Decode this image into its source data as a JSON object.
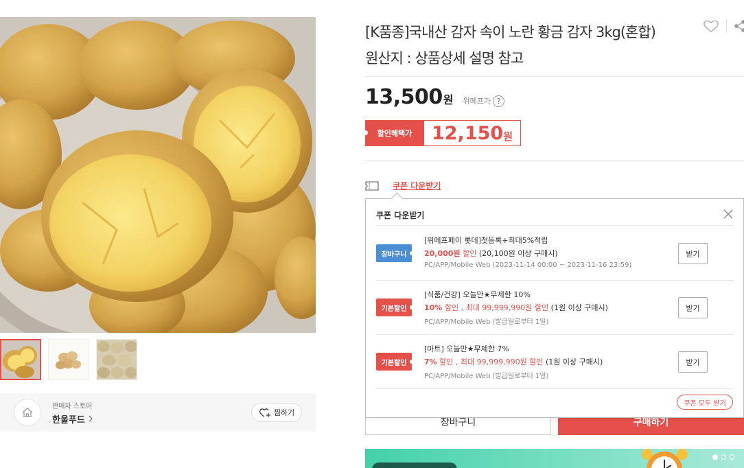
{
  "product": {
    "title_line1": "[K품종]국내산 감자 속이 노란 황금 감자 3kg(혼합)",
    "title_line2": "원산지 : 상품상세 설명 참고",
    "wish_icon": "heart-outline-icon",
    "share_icon": "share-icon"
  },
  "price": {
    "value": "13,500",
    "won": "원",
    "tag": "위메프가",
    "help": "?"
  },
  "discount": {
    "label": "할인혜택가",
    "value": "12,150",
    "won": "원"
  },
  "coupon_link": {
    "label": "쿠폰 다운받기",
    "icon": "coupon-ticket-icon"
  },
  "coupon_panel": {
    "title": "쿠폰 다운받기",
    "close_icon": "close-icon",
    "coupons": [
      {
        "badge": "장바구니",
        "name": "[위메프페이 롯데]첫등록+최대5%적립",
        "discount_amount": "20,000원",
        "discount_word": " 할인",
        "discount_max": "",
        "condition": " (20,100원 이상 구매시)",
        "period": "PC/APP/Mobile Web (2023-11-14 00:00 ~ 2023-11-16 23:59)",
        "button": "받기"
      },
      {
        "badge": "기본할인",
        "name": "[식품/건강] 오늘만★무제한 10%",
        "discount_amount": "10%",
        "discount_word": " 할인",
        "discount_max": " , 최대 99,999,990원 할인",
        "condition": " (1원 이상 구매시)",
        "period": "PC/APP/Mobile Web (발급일로부터 1일)",
        "button": "받기"
      },
      {
        "badge": "기본할인",
        "name": "[마트] 오늘만★무제한 7%",
        "discount_amount": "7%",
        "discount_word": " 할인",
        "discount_max": " , 최대 99,999,990원 할인",
        "condition": " (1원 이상 구매시)",
        "period": "PC/APP/Mobile Web (발급일로부터 1일)",
        "button": "받기"
      }
    ],
    "download_all": "쿠폰 모두 받기"
  },
  "actions": {
    "cart": "장바구니",
    "buy": "구매하기"
  },
  "seller": {
    "label": "판매자 스토어",
    "name": "한울푸드",
    "zzim": "찜하기",
    "home_icon": "home-icon",
    "zzim_icon": "heart-plus-icon"
  },
  "colors": {
    "accent": "#e5504b",
    "badge_blue": "#4a8fd6",
    "banner": "#43d1a9"
  }
}
